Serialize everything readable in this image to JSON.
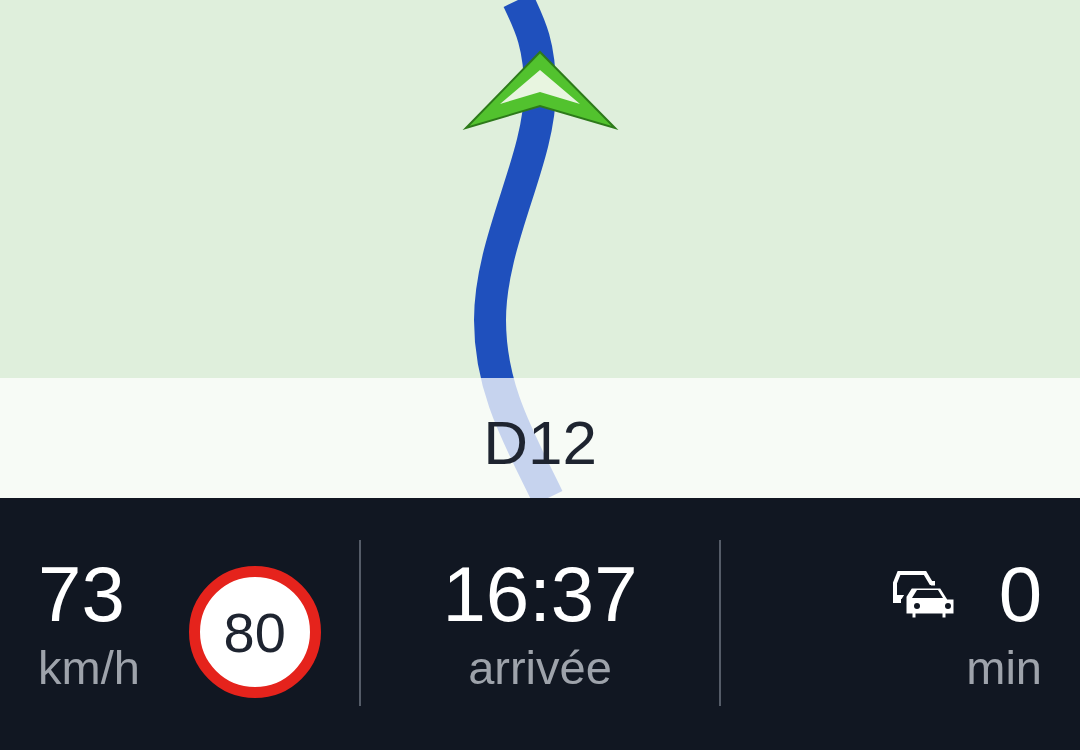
{
  "street": "D12",
  "speed": {
    "value": "73",
    "unit": "km/h"
  },
  "speed_limit": "80",
  "arrival": {
    "time": "16:37",
    "label": "arrivée"
  },
  "traffic_delay": {
    "value": "0",
    "unit": "min"
  }
}
